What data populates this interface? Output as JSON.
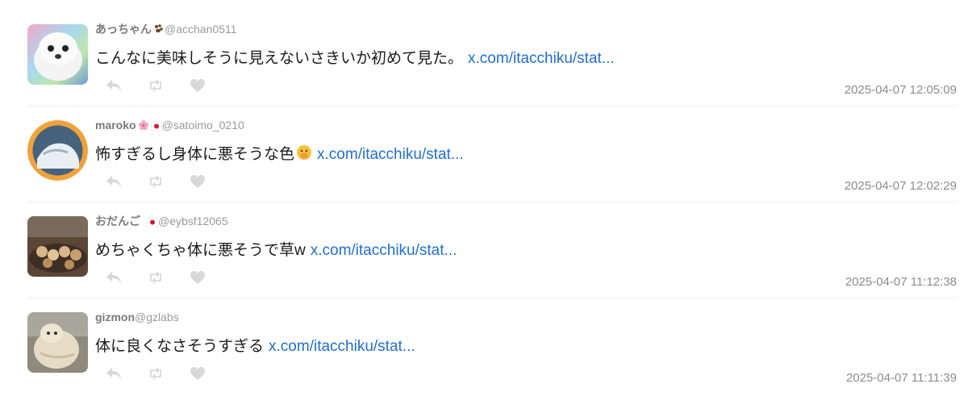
{
  "tweets": [
    {
      "name": "あっちゃん",
      "name_emoji": "paw-prints-icon",
      "handle": "@acchan0511",
      "text": "こんなに美味しそうに見えないさきいか初めて見た。",
      "link": "x.com/itacchiku/stat...",
      "timestamp": "2025-04-07 12:05:09",
      "avatar": "seal-avatar"
    },
    {
      "name": "maroko",
      "name_emoji": "cherry-blossom-and-japan-flag-icon",
      "handle": "@satoimo_0210",
      "text": "怖すぎるし身体に悪そうな色",
      "text_emoji": "face-with-hand-over-mouth-icon",
      "link": "x.com/itacchiku/stat...",
      "timestamp": "2025-04-07 12:02:29",
      "avatar": "orange-frame-avatar"
    },
    {
      "name": "おだんご",
      "name_emoji": "japan-flag-icon",
      "handle": "@eybsf12065",
      "text": "めちゃくちゃ体に悪そうで草w",
      "link": "x.com/itacchiku/stat...",
      "timestamp": "2025-04-07 11:12:38",
      "avatar": "dango-avatar"
    },
    {
      "name": "gizmon",
      "handle": "@gzlabs",
      "text": "体に良くなさそうすぎる",
      "link": "x.com/itacchiku/stat...",
      "timestamp": "2025-04-07 11:11:39",
      "avatar": "knit-animal-avatar"
    }
  ],
  "colors": {
    "link": "#1f6fd1",
    "muted": "#9a9a9a",
    "action_icon": "#d8d8d8",
    "divider": "#ececec"
  }
}
